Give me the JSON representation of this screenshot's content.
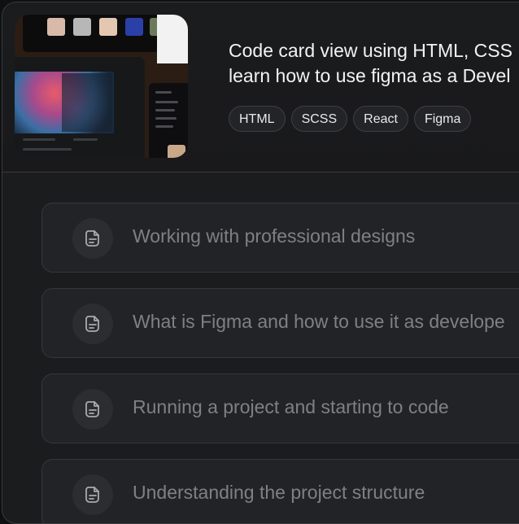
{
  "course": {
    "title_line1": "Code card view using HTML, CSS",
    "title_line2": "learn how to use figma as a Devel",
    "thumbnail_icon": "course-thumbnail-image"
  },
  "tags": [
    {
      "label": "HTML"
    },
    {
      "label": "SCSS"
    },
    {
      "label": "React"
    },
    {
      "label": "Figma"
    }
  ],
  "lessons": [
    {
      "label": "Working with professional designs",
      "icon": "document-icon"
    },
    {
      "label": "What is Figma and how to use it as develope",
      "icon": "document-icon"
    },
    {
      "label": "Running a project and starting to code",
      "icon": "document-icon"
    },
    {
      "label": "Understanding the project structure",
      "icon": "document-icon"
    }
  ],
  "colors": {
    "card_bg": "#1b1c1e",
    "lesson_bg": "#222326",
    "lesson_text": "#7f8085",
    "title_text": "#f3f3f4",
    "border": "#3a3b3e"
  }
}
